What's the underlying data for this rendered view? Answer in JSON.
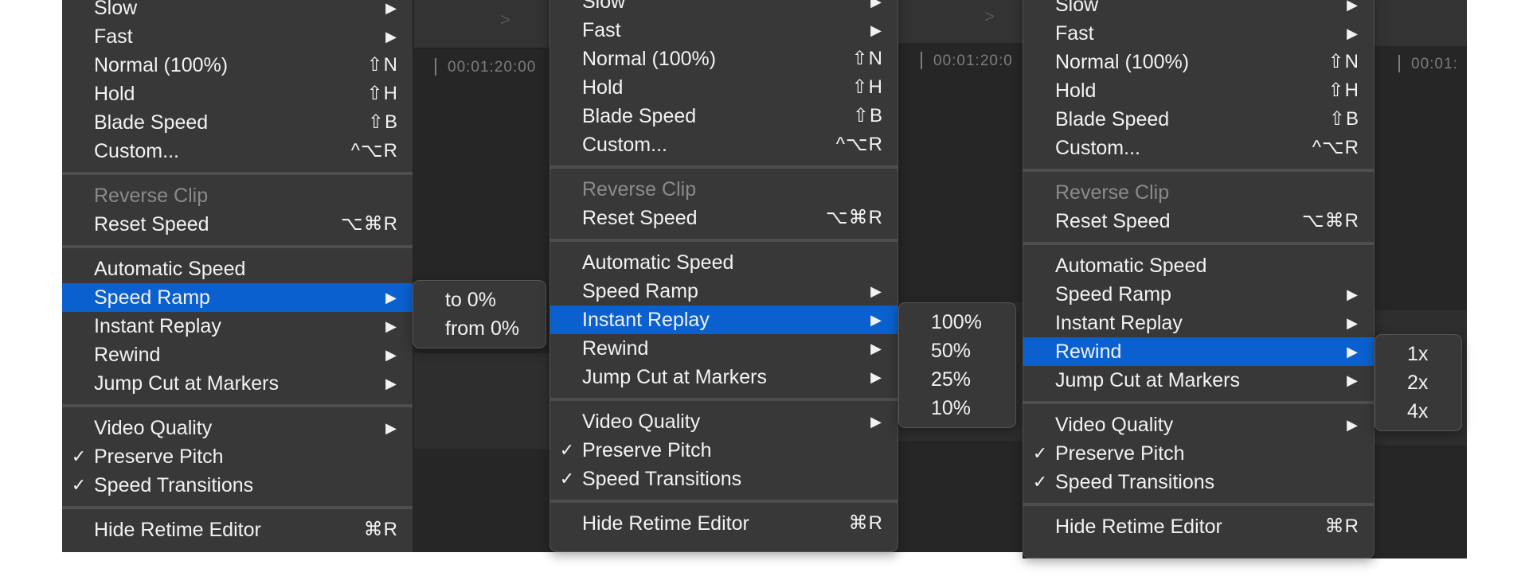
{
  "menu": {
    "items": [
      {
        "label": "Slow",
        "arrow": true
      },
      {
        "label": "Fast",
        "arrow": true
      },
      {
        "label": "Normal (100%)",
        "shortcut": "⇧N"
      },
      {
        "label": "Hold",
        "shortcut": "⇧H"
      },
      {
        "label": "Blade Speed",
        "shortcut": "⇧B"
      },
      {
        "label": "Custom...",
        "shortcut": "^⌥R"
      },
      {
        "label": "Reverse Clip",
        "disabled": true
      },
      {
        "label": "Reset Speed",
        "shortcut": "⌥⌘R"
      },
      {
        "label": "Automatic Speed"
      },
      {
        "label": "Speed Ramp",
        "arrow": true
      },
      {
        "label": "Instant Replay",
        "arrow": true
      },
      {
        "label": "Rewind",
        "arrow": true
      },
      {
        "label": "Jump Cut at Markers",
        "arrow": true
      },
      {
        "label": "Video Quality",
        "arrow": true
      },
      {
        "label": "Preserve Pitch",
        "checked": true
      },
      {
        "label": "Speed Transitions",
        "checked": true
      },
      {
        "label": "Hide Retime Editor",
        "shortcut": "⌘R"
      }
    ],
    "checkmark": "✓",
    "arrow_glyph": "▶"
  },
  "panels": [
    {
      "highlighted": "Speed Ramp",
      "submenu": [
        "to 0%",
        "from 0%"
      ]
    },
    {
      "highlighted": "Instant Replay",
      "submenu": [
        "100%",
        "50%",
        "25%",
        "10%"
      ]
    },
    {
      "highlighted": "Rewind",
      "submenu": [
        "1x",
        "2x",
        "4x"
      ]
    }
  ],
  "timeline": {
    "timecodes": [
      "00:01:20:00",
      "00:01:20:0",
      "00:01:"
    ]
  },
  "colors": {
    "menu_bg": "#383838",
    "highlight": "#0a60cf",
    "separator": "#4e4e4e",
    "text": "#f2f2f2",
    "disabled": "#8a8a8a"
  }
}
